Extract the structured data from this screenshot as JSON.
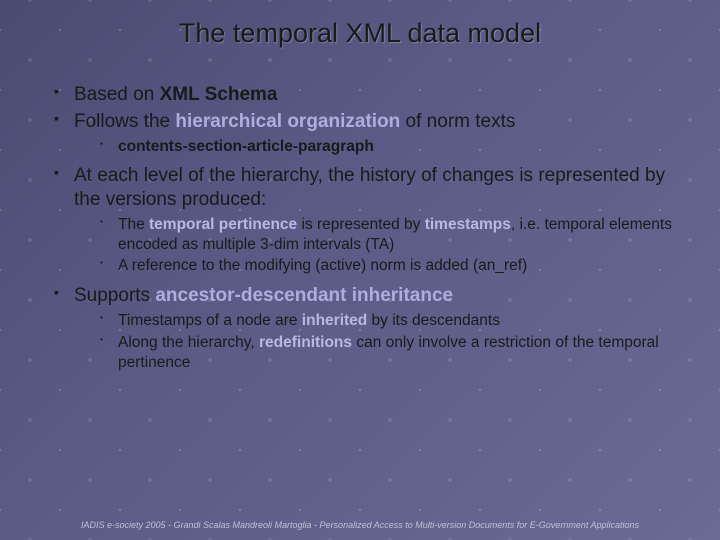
{
  "title": "The temporal XML data model",
  "b1_pre": "Based on ",
  "b1_bold": "XML Schema",
  "b2_pre": "Follows the ",
  "b2_term": "hierarchical organization",
  "b2_post": " of norm texts",
  "b2_1_bold": "contents-section-article-paragraph",
  "b3": "At each level of the hierarchy, the history of changes is represented by the versions produced:",
  "b3_1_a": "The ",
  "b3_1_term1": "temporal pertinence",
  "b3_1_b": " is represented by ",
  "b3_1_term2": "timestamps",
  "b3_1_c": ", i.e. temporal elements encoded as multiple 3-dim intervals (TA)",
  "b3_2": "A reference to the modifying (active) norm is added (an_ref)",
  "b4_pre": "Supports ",
  "b4_term": "ancestor-descendant inheritance",
  "b4_1_a": "Timestamps of a node are ",
  "b4_1_term": "inherited",
  "b4_1_b": " by its descendants",
  "b4_2_a": "Along the hierarchy, ",
  "b4_2_term": "redefinitions",
  "b4_2_b": " can only involve a restriction of the temporal pertinence",
  "footer": "IADIS e-society 2005  -  Grandi  Scalas  Mandreoli  Martoglia  -  Personalized Access to Multi-version Documents for E-Government Applications"
}
